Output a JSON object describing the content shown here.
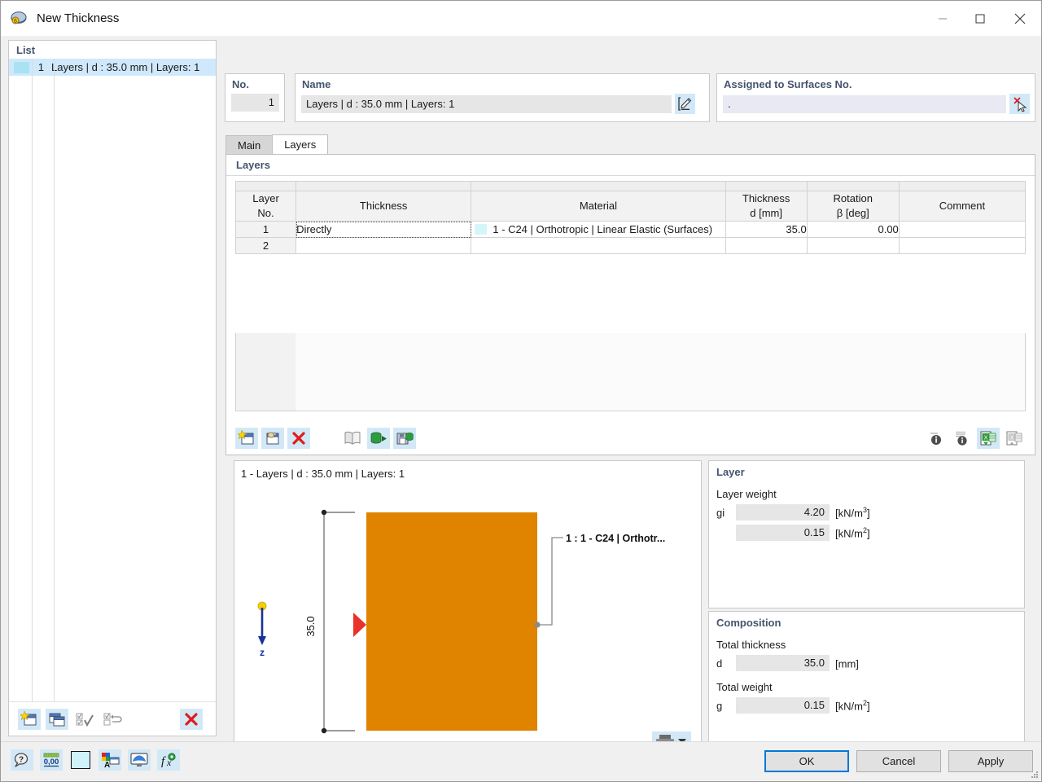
{
  "window": {
    "title": "New Thickness",
    "icon": "thickness-icon",
    "controls": {
      "minimize": "minimize-icon",
      "maximize": "maximize-icon",
      "close": "close-icon"
    }
  },
  "list_panel": {
    "header": "List",
    "rows": [
      {
        "no": "1",
        "label": "Layers | d : 35.0 mm | Layers: 1",
        "swatch_color": "#a9e2f3",
        "selected": true
      }
    ],
    "toolbar": [
      {
        "name": "new-item-button",
        "icon": "new-window-icon"
      },
      {
        "name": "copy-item-button",
        "icon": "copy-window-icon"
      },
      {
        "name": "select-all-button",
        "icon": "check-all-icon",
        "disabled": true
      },
      {
        "name": "invert-selection-button",
        "icon": "invert-selection-icon",
        "disabled": true
      },
      {
        "name": "delete-item-button",
        "icon": "red-x-icon"
      }
    ]
  },
  "fields": {
    "no": {
      "label": "No.",
      "value": "1"
    },
    "name": {
      "label": "Name",
      "value": "Layers | d : 35.0 mm | Layers: 1",
      "edit_button": "edit-name-icon"
    },
    "assigned": {
      "label": "Assigned to Surfaces No.",
      "value": ".",
      "pick_button": "pick-surfaces-icon"
    }
  },
  "tabs": [
    {
      "label": "Main",
      "active": false
    },
    {
      "label": "Layers",
      "active": true
    }
  ],
  "layers_section": {
    "header": "Layers",
    "columns": [
      {
        "line1": "Layer",
        "line2": "No."
      },
      {
        "line1": "Thickness",
        "line2": ""
      },
      {
        "line1": "Material",
        "line2": ""
      },
      {
        "line1": "Thickness",
        "line2": "d [mm]"
      },
      {
        "line1": "Rotation",
        "line2": "β [deg]"
      },
      {
        "line1": "Comment",
        "line2": ""
      }
    ],
    "rows": [
      {
        "no": "1",
        "thickness_type": "Directly",
        "material": "1 - C24 | Orthotropic | Linear Elastic (Surfaces)",
        "material_swatch": "#d4f6fa",
        "thickness_d": "35.0",
        "rotation": "0.00",
        "comment": ""
      },
      {
        "no": "2",
        "thickness_type": "",
        "material": "",
        "material_swatch": "",
        "thickness_d": "",
        "rotation": "",
        "comment": ""
      }
    ],
    "toolbar_left": [
      {
        "name": "new-layer-button",
        "icon": "new-window-icon"
      },
      {
        "name": "import-layer-button",
        "icon": "import-window-icon"
      },
      {
        "name": "delete-layer-button",
        "icon": "red-x-icon"
      },
      {
        "name": "layer-library-button",
        "icon": "book-icon",
        "disabled": true
      },
      {
        "name": "import-from-library-button",
        "icon": "db-import-icon"
      },
      {
        "name": "export-to-library-button",
        "icon": "db-save-icon"
      }
    ],
    "toolbar_right": [
      {
        "name": "info-button",
        "icon": "info-circle-icon",
        "disabled": true
      },
      {
        "name": "details-info-button",
        "icon": "info-lines-icon",
        "disabled": true
      },
      {
        "name": "excel-import-button",
        "icon": "excel-down-icon"
      },
      {
        "name": "excel-export-button",
        "icon": "excel-up-icon",
        "disabled": true
      }
    ]
  },
  "diagram": {
    "title": "1 - Layers | d : 35.0 mm | Layers: 1",
    "dimension_label": "35.0",
    "layer_callout": "1 : 1 - C24 | Orthotr...",
    "axis_label": "z",
    "layer_color": "#e08400",
    "print_button": "print-icon"
  },
  "layer_info": {
    "header": "Layer",
    "sub": "Layer weight",
    "rows": [
      {
        "symbol": "gi",
        "value": "4.20",
        "unit": "[kN/m",
        "exp": "3",
        "unit_end": "]"
      },
      {
        "symbol": "",
        "value": "0.15",
        "unit": "[kN/m",
        "exp": "2",
        "unit_end": "]"
      }
    ]
  },
  "composition": {
    "header": "Composition",
    "total_thickness_label": "Total thickness",
    "total_thickness": {
      "symbol": "d",
      "value": "35.0",
      "unit": "[mm]",
      "exp": "",
      "unit_end": ""
    },
    "total_weight_label": "Total weight",
    "total_weight": {
      "symbol": "g",
      "value": "0.15",
      "unit": "[kN/m",
      "exp": "2",
      "unit_end": "]"
    }
  },
  "bottom_bar": {
    "tools": [
      {
        "name": "help-button",
        "icon": "help-magnifier-icon"
      },
      {
        "name": "units-button",
        "icon": "units-000-icon"
      },
      {
        "name": "color-swatch-button",
        "icon": "color-box-icon",
        "color": "#cff2fb"
      },
      {
        "name": "display-properties-button",
        "icon": "colors-config-icon"
      },
      {
        "name": "visual-settings-button",
        "icon": "monitor-icon"
      },
      {
        "name": "formula-button",
        "icon": "fx-icon"
      }
    ],
    "buttons": {
      "ok": "OK",
      "cancel": "Cancel",
      "apply": "Apply"
    }
  },
  "colors": {
    "accent_blue": "#0078d7",
    "header_blue": "#44546e",
    "selection": "#cfe8fb",
    "layer_orange": "#e08400",
    "red": "#e01b1b"
  }
}
